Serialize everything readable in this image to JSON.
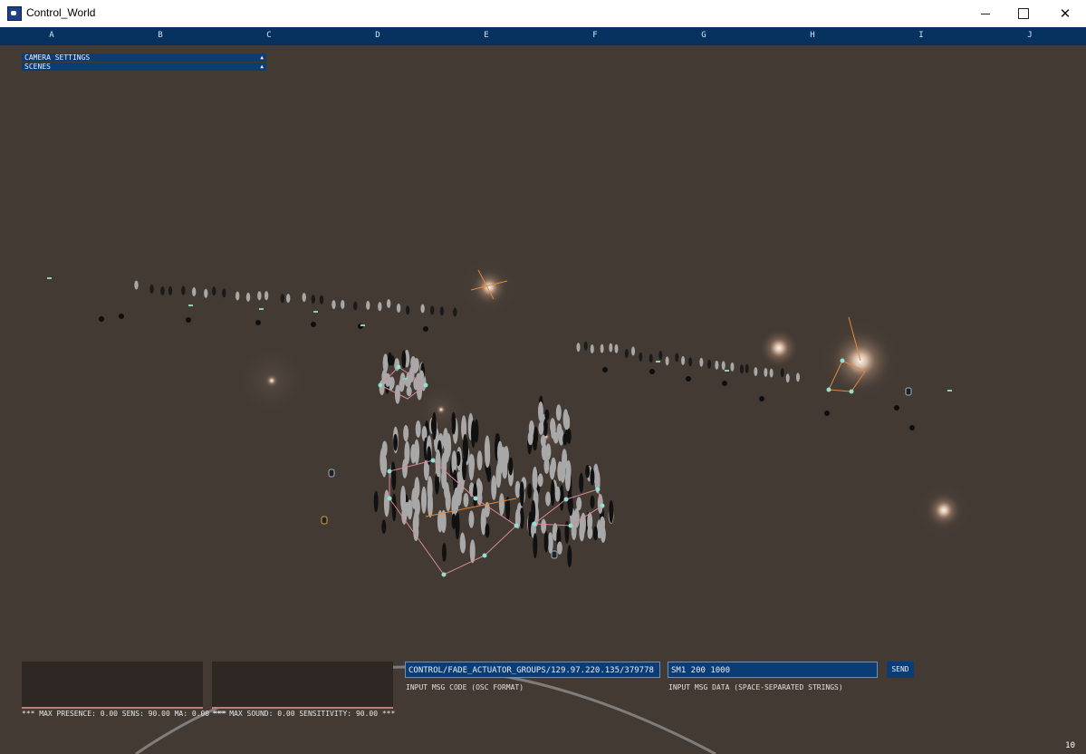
{
  "window": {
    "title": "Control_World",
    "minimize_icon": "minimize-icon",
    "maximize_icon": "maximize-icon",
    "close_icon": "close-icon"
  },
  "columns": [
    "A",
    "B",
    "C",
    "D",
    "E",
    "F",
    "G",
    "H",
    "I",
    "J"
  ],
  "menus": [
    {
      "label": "CAMERA SETTINGS",
      "icon": "triangle-up-icon"
    },
    {
      "label": "SCENES",
      "icon": "triangle-up-icon"
    }
  ],
  "meters": {
    "presence_text": "*** MAX PRESENCE: 0.00  SENS: 90.00 MA: 0.00 ***",
    "sound_text": "*** MAX SOUND: 0.00  SENSITIVITY: 90.00 ***"
  },
  "message": {
    "code_value": "CONTROL/FADE_ACTUATOR_GROUPS/129.97.220.135/379778",
    "code_caption": "INPUT MSG CODE (OSC FORMAT)",
    "data_value": "SM1 200 1000",
    "data_caption": "INPUT MSG DATA (SPACE-SEPARATED STRINGS)",
    "send_label": "SEND"
  },
  "status": {
    "fps": "10"
  },
  "colors": {
    "background": "#433a33",
    "ui_panel": "#0b3c73",
    "column_bar": "#07325f",
    "glow": "#f2c9a8",
    "connector_orange": "#e08a3c",
    "connector_pink": "#d98a9a",
    "node_cyan": "#8fe0d0"
  }
}
